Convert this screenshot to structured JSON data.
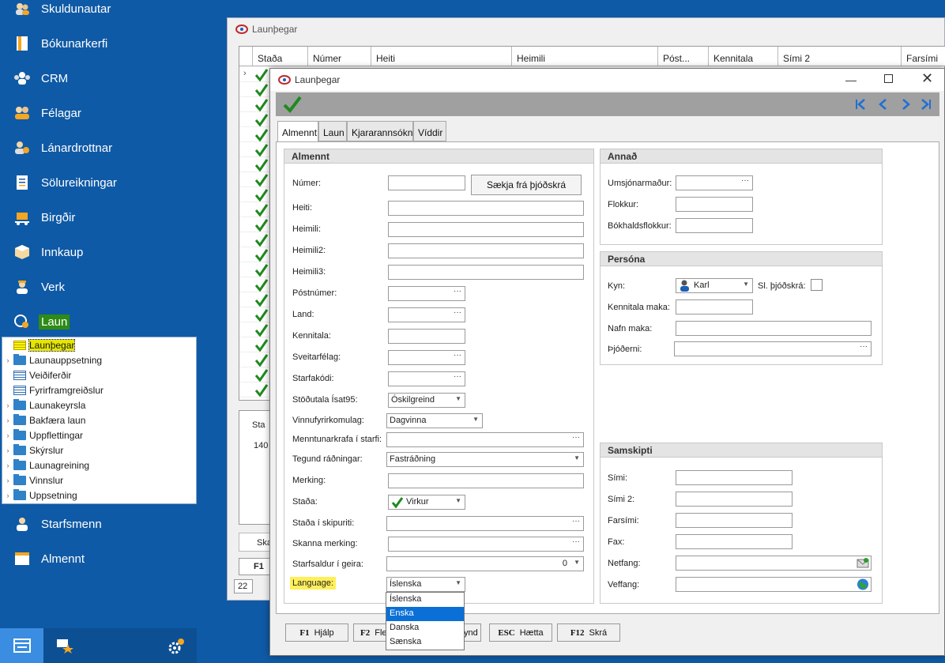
{
  "sidebar": {
    "items": [
      {
        "label": "Skuldunautar",
        "icon": "people-icon"
      },
      {
        "label": "Bókunarkerfi",
        "icon": "book-icon"
      },
      {
        "label": "CRM",
        "icon": "crm-icon"
      },
      {
        "label": "Félagar",
        "icon": "members-icon"
      },
      {
        "label": "Lánardrottnar",
        "icon": "creditors-icon"
      },
      {
        "label": "Sölureikningar",
        "icon": "invoice-icon"
      },
      {
        "label": "Birgðir",
        "icon": "inventory-icon"
      },
      {
        "label": "Innkaup",
        "icon": "box-icon"
      },
      {
        "label": "Verk",
        "icon": "worker-icon"
      },
      {
        "label": "Laun",
        "icon": "payroll-icon"
      }
    ],
    "tree": [
      {
        "label": "Launþegar",
        "type": "grid",
        "selected": true
      },
      {
        "label": "Launauppsetning",
        "type": "folder"
      },
      {
        "label": "Veiðiferðir",
        "type": "grid"
      },
      {
        "label": "Fyrirframgreiðslur",
        "type": "grid"
      },
      {
        "label": "Launakeyrsla",
        "type": "folder"
      },
      {
        "label": "Bakfæra laun",
        "type": "folder"
      },
      {
        "label": "Uppflettingar",
        "type": "folder"
      },
      {
        "label": "Skýrslur",
        "type": "folder"
      },
      {
        "label": "Launagreining",
        "type": "folder"
      },
      {
        "label": "Vinnslur",
        "type": "folder"
      },
      {
        "label": "Uppsetning",
        "type": "folder"
      }
    ],
    "bottom_items": [
      {
        "label": "Starfsmenn",
        "icon": "employee-icon"
      },
      {
        "label": "Almennt",
        "icon": "window-icon"
      }
    ]
  },
  "bg_window": {
    "title": "Launþegar",
    "columns": [
      "Staða",
      "Númer",
      "Heiti",
      "Heimili",
      "Póst...",
      "Kennitala",
      "Sími 2",
      "Farsími"
    ],
    "lower": {
      "col": "Sta",
      "row_value": "140",
      "ska": "Ska",
      "f1": "F1",
      "count": "22"
    }
  },
  "dialog": {
    "title": "Launþegar",
    "tabs": [
      "Almennt",
      "Laun",
      "Kjararannsókn",
      "Víddir"
    ],
    "almennt": {
      "header": "Almennt",
      "numer_label": "Númer:",
      "fetch_button": "Sækja frá þjóðskrá",
      "fields": {
        "heiti": "Heiti:",
        "heimili": "Heimili:",
        "heimili2": "Heimili2:",
        "heimili3": "Heimili3:",
        "postnumer": "Póstnúmer:",
        "land": "Land:",
        "kennitala": "Kennitala:",
        "sveitarfelag": "Sveitarfélag:",
        "starfakodi": "Starfakódi:",
        "stodutala": "Stöðutala Ísat95:",
        "vinnufyrirkomulag": "Vinnufyrirkomulag:",
        "menntunarkrafa": "Menntunarkrafa í starfi:",
        "tegund": "Tegund ráðningar:",
        "merking": "Merking:",
        "stada": "Staða:",
        "stada_skipuriti": "Staða í skipuriti:",
        "skanna": "Skanna merking:",
        "starfsaldur": "Starfsaldur í geira:",
        "language": "Language:"
      },
      "values": {
        "stodutala": "Óskilgreind",
        "vinnufyrirkomulag": "Dagvinna",
        "tegund": "Fastráðning",
        "stada": "Virkur",
        "starfsaldur": "0",
        "language": "Íslenska"
      },
      "language_options": [
        "Íslenska",
        "Enska",
        "Danska",
        "Sænska"
      ],
      "language_highlight": "Enska"
    },
    "annad": {
      "header": "Annað",
      "umsjonarmadur": "Umsjónarmaður:",
      "flokkur": "Flokkur:",
      "bokhaldsflokkur": "Bókhaldsflokkur:"
    },
    "persona": {
      "header": "Persóna",
      "kyn": "Kyn:",
      "kyn_value": "Karl",
      "sl": "Sl. þjóðskrá:",
      "kennitala_maka": "Kennitala maka:",
      "nafn_maka": "Nafn maka:",
      "thjoderni": "Þjóðerni:"
    },
    "samskipti": {
      "header": "Samskipti",
      "simi": "Sími:",
      "simi2": "Sími 2:",
      "farsimi": "Farsími:",
      "fax": "Fax:",
      "netfang": "Netfang:",
      "veffang": "Veffang:"
    },
    "footer": [
      {
        "key": "F1",
        "label": "Hjálp"
      },
      {
        "key": "F2",
        "label": "Fle"
      },
      {
        "key": "",
        "label": "ynd"
      },
      {
        "key": "ESC",
        "label": "Hætta"
      },
      {
        "key": "F12",
        "label": "Skrá"
      }
    ]
  },
  "colors": {
    "sidebar": "#0f5aa6",
    "active": "#2e8b16",
    "highlight": "#e6e600",
    "selection": "#0a6fd6"
  }
}
